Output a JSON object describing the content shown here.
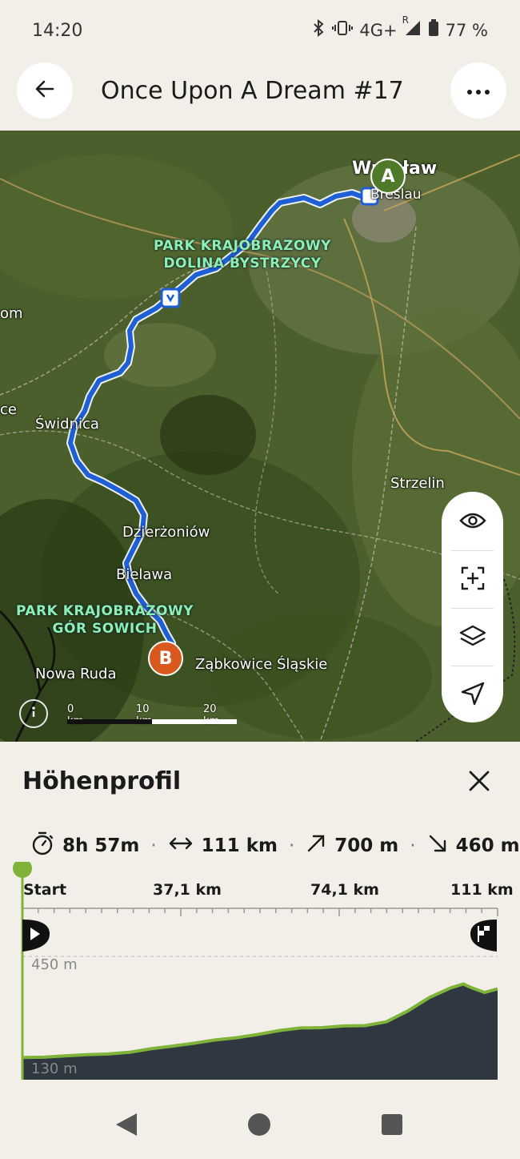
{
  "status_bar": {
    "time": "14:20",
    "network": "4G+",
    "roaming": "R",
    "battery": "77 %"
  },
  "header": {
    "title": "Once Upon A Dream #17",
    "back_icon": "arrow-left-icon",
    "more_icon": "more-horizontal-icon"
  },
  "map": {
    "labels": {
      "wroclaw": "Wrocław",
      "breslau": "Breslau",
      "swidnica": "Świdnica",
      "strzelin": "Strzelin",
      "dzierzoniow": "Dzierżoniów",
      "bielawa": "Bielawa",
      "nowa_ruda": "Nowa Ruda",
      "zabkowice": "Ząbkowice Śląskie",
      "om": "om",
      "ce": "ce"
    },
    "parks": {
      "bystrzycy_line1": "PARK KRAJOBRAZOWY",
      "bystrzycy_line2": "DOLINA BYSTRZYCY",
      "sowich_line1": "PARK KRAJOBRAZOWY",
      "sowich_line2": "GÓR SOWICH"
    },
    "start_marker": "A",
    "end_marker": "B",
    "scale": {
      "l0": "0 km",
      "l1": "10 km",
      "l2": "20 km"
    },
    "route_color": "#1f5fd6",
    "controls": [
      "eye-icon",
      "zoom-fit-icon",
      "layers-icon",
      "navigation-icon"
    ]
  },
  "sheet": {
    "title": "Höhenprofil",
    "stats": {
      "duration": "8h 57m",
      "distance": "111 km",
      "ascent": "700 m",
      "descent": "460 m"
    },
    "km_axis": [
      "Start",
      "37,1 km",
      "74,1 km",
      "111 km"
    ],
    "elev_max": "450 m",
    "elev_min": "130 m",
    "accent": "#7fb33a",
    "fill": "#2f3741"
  },
  "chart_data": {
    "type": "area",
    "x_unit": "km",
    "y_unit": "m",
    "xlim": [
      0,
      111
    ],
    "x": [
      0,
      5,
      10,
      15,
      20,
      25,
      30,
      35,
      40,
      45,
      50,
      55,
      60,
      65,
      70,
      75,
      80,
      85,
      90,
      95,
      100,
      103,
      105,
      108,
      111
    ],
    "y": [
      139,
      140,
      144,
      148,
      150,
      155,
      166,
      174,
      183,
      193,
      200,
      210,
      222,
      230,
      231,
      236,
      237,
      249,
      282,
      323,
      353,
      365,
      353,
      339,
      350
    ]
  }
}
